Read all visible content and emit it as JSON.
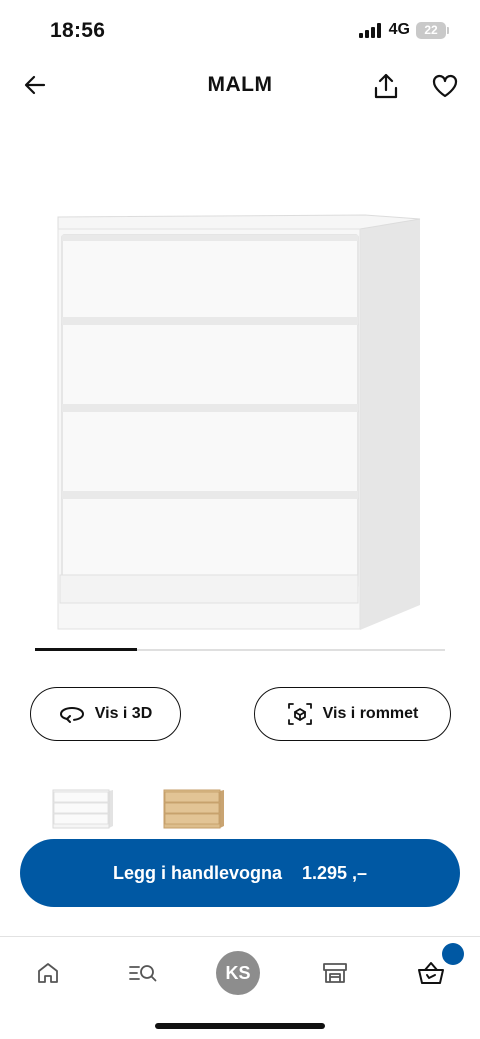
{
  "status": {
    "time": "18:56",
    "network": "4G",
    "battery": "22"
  },
  "nav": {
    "title": "MALM",
    "back_icon": "arrow-left-icon",
    "share_icon": "share-icon",
    "favorite_icon": "heart-icon"
  },
  "product": {
    "image": "white-chest-of-drawers",
    "gallery_position": 1
  },
  "actions": {
    "view_3d": "Vis i 3D",
    "view_in_room": "Vis i rommet"
  },
  "variants": [
    {
      "name": "white",
      "color": "#f2f2f2"
    },
    {
      "name": "white-stained-oak",
      "color": "#d8b98a"
    }
  ],
  "cart_button": {
    "label": "Legg i handlevogna",
    "price": "1.295 ,–"
  },
  "tabbar": {
    "profile_initials": "KS",
    "items": [
      "home-icon",
      "search-icon",
      "profile-avatar",
      "store-icon",
      "cart-icon"
    ]
  },
  "colors": {
    "brand_blue": "#0058a3",
    "avatar_gray": "#8d8d8d"
  }
}
